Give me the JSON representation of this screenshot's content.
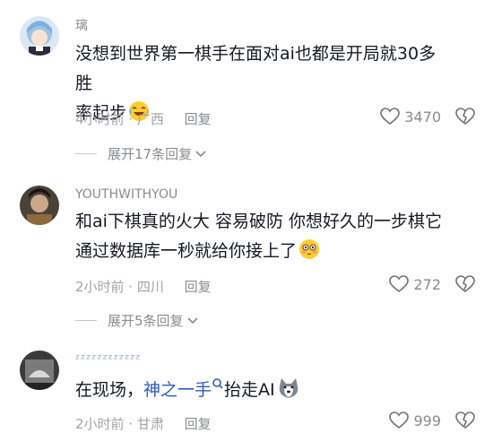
{
  "comments": [
    {
      "username": "璃",
      "text": "没想到世界第一棋手在面对ai也都是开局就30多胜率起步",
      "line1": "没想到世界第一棋手在面对ai也都是开局就30多胜",
      "line2": "率起步",
      "emoji": "laughing-crying-emoji",
      "time": "4小时前",
      "location": "广西",
      "reply_label": "回复",
      "likes": "3470",
      "expand": "展开17条回复"
    },
    {
      "username": "YOUTHWITHYOU",
      "line1": "和ai下棋真的火大 容易破防 你想好久的一步棋它",
      "line2": "通过数据库一秒就给你接上了",
      "emoji": "flushed-emoji",
      "time": "2小时前",
      "location": "四川",
      "reply_label": "回复",
      "likes": "272",
      "expand": "展开5条回复"
    },
    {
      "username": "ᶻᶻᶻᶻᶻᶻᶻᶻᶻᶻᶻᶻ",
      "text_prefix": "在现场，",
      "text_link": "神之一手",
      "text_suffix": "抬走AI",
      "emoji": "husky-emoji",
      "time": "2小时前",
      "location": "甘肃",
      "reply_label": "回复",
      "likes": "999"
    }
  ],
  "colors": {
    "text": "#161823",
    "meta": "#a3a4a8",
    "link": "#2e5bba"
  }
}
